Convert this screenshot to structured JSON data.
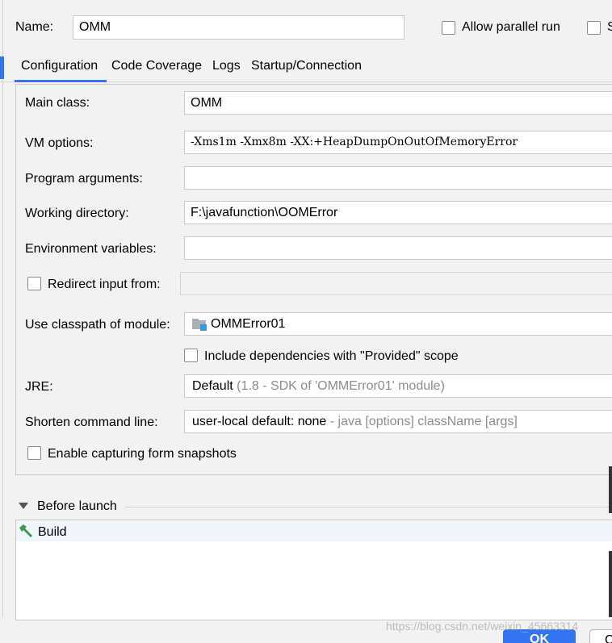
{
  "header": {
    "name_label": "Name:",
    "name_value": "OMM",
    "allow_parallel_label": "Allow parallel run",
    "cut_checkbox_label": "S"
  },
  "tabs": [
    {
      "label": "Configuration",
      "selected": true
    },
    {
      "label": "Code Coverage",
      "selected": false
    },
    {
      "label": "Logs",
      "selected": false
    },
    {
      "label": "Startup/Connection",
      "selected": false
    }
  ],
  "form": {
    "main_class": {
      "label": "Main class:",
      "value": "OMM"
    },
    "vm_options": {
      "label": "VM options:",
      "value": "-Xms1m -Xmx8m -XX:+HeapDumpOnOutOfMemoryError"
    },
    "program_arguments": {
      "label": "Program arguments:",
      "value": ""
    },
    "working_directory": {
      "label": "Working directory:",
      "value": "F:\\javafunction\\OOMError"
    },
    "environment_variables": {
      "label": "Environment variables:",
      "value": ""
    },
    "redirect_input": {
      "label": "Redirect input from:",
      "value": ""
    },
    "classpath_module": {
      "label": "Use classpath of module:",
      "value": "OMMError01"
    },
    "include_dependencies": {
      "label": "Include dependencies with \"Provided\" scope"
    },
    "jre": {
      "label": "JRE:",
      "value": "Default",
      "hint": "(1.8 - SDK of 'OMMError01' module)"
    },
    "shorten_command_line": {
      "label": "Shorten command line:",
      "value": "user-local default: none",
      "hint": "- java [options] className [args]"
    },
    "enable_capturing": {
      "label": "Enable capturing form snapshots"
    }
  },
  "before_launch": {
    "title": "Before launch",
    "items": [
      {
        "label": "Build",
        "icon": "hammer-icon"
      }
    ]
  },
  "buttons": {
    "ok_label": "OK",
    "other_label": "C"
  },
  "watermark": "https://blog.csdn.net/weixin_45663314",
  "colors": {
    "accent": "#3574f0",
    "build_icon": "#3a9b4c",
    "module_icon": "#3a9ad9"
  }
}
